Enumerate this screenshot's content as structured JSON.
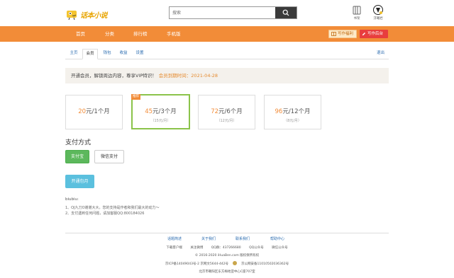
{
  "header": {
    "logo_text": "话本小说",
    "search_placeholder": "搜索",
    "bookshelf_label": "书架",
    "user_label": "浮曦岩"
  },
  "nav": {
    "items": [
      "首页",
      "分类",
      "排行榜",
      "手机版"
    ],
    "write_label": "写作福利",
    "admin_label": "写作后台"
  },
  "tabs": {
    "items": [
      "主页",
      "会员",
      "钱包",
      "收益",
      "设置"
    ],
    "active": "会员",
    "logout": "退出"
  },
  "notice": {
    "text": "开通会员，解锁周边内容，尊享VIP特识！",
    "expiry": "会员到期时间：2021-04-28"
  },
  "plans": [
    {
      "num": "20",
      "unit": "元/1个月",
      "sub": "",
      "badge": ""
    },
    {
      "num": "45",
      "unit": "元/3个月",
      "sub": "（15元/月）",
      "badge": "推荐"
    },
    {
      "num": "72",
      "unit": "元/6个月",
      "sub": "（12元/月）",
      "badge": ""
    },
    {
      "num": "96",
      "unit": "元/12个月",
      "sub": "（8元/月）",
      "badge": ""
    }
  ],
  "payment": {
    "title": "支付方式",
    "alipay": "支付宝",
    "wechat": "微信支付",
    "open_button": "开通包月"
  },
  "user": {
    "name": "biubiu:"
  },
  "tips": [
    "1、OJ九刀O谢谢大大，您的支持是作者和我们最大的动力～",
    "2、支付遇到任何问题，请加客服QQ:800184026"
  ],
  "footer": {
    "links": [
      "话题简述",
      "关于我们",
      "联系我们",
      "帮助中心"
    ],
    "row1": [
      "下载客户端",
      "关注微博",
      "QQ群：437266680",
      "QQ公众号",
      "微信公众号"
    ],
    "copyright": "© 2016-2020 iHuaBen.com 版权保所有权",
    "icp": "京ICP备14049043号-2 京网文5644-442号",
    "police": "京公网安备11010502036362号",
    "address": "北京市朝阳区东方梅地亚中心C座707室"
  },
  "colors": {
    "nav_orange": "#f28c38",
    "accent_orange": "#e58a2e",
    "link_blue": "#2b6cb0",
    "selected_green": "#8bc34a",
    "pay_green": "#5cb85c",
    "open_blue": "#5bc0de"
  },
  "icons": {
    "logo": "chameleon-logo-icon",
    "search": "search-icon",
    "bookshelf": "bookshelf-icon",
    "avatar": "avatar-icon",
    "write": "book-icon",
    "admin": "pen-icon"
  }
}
